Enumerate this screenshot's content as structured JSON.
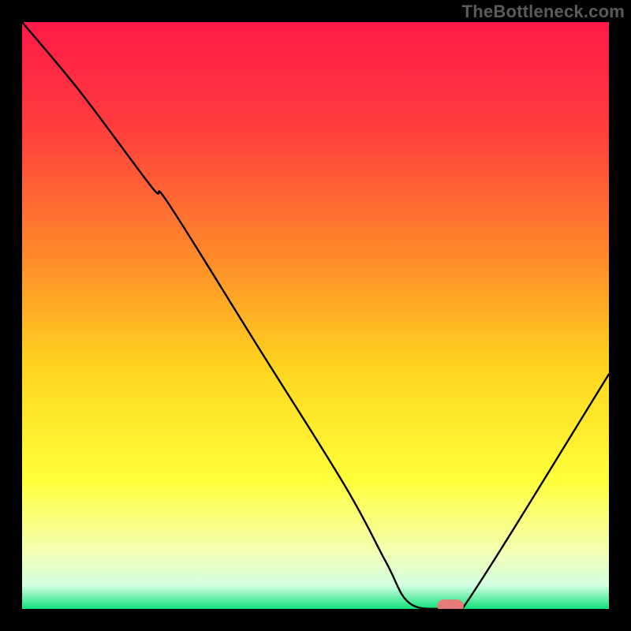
{
  "watermark": "TheBottleneck.com",
  "chart_data": {
    "type": "line",
    "title": "",
    "xlabel": "",
    "ylabel": "",
    "xlim": [
      0,
      100
    ],
    "ylim": [
      0,
      100
    ],
    "grid": false,
    "legend": false,
    "background_gradient": {
      "stops": [
        {
          "pos": 0.0,
          "color": "#ff1a49"
        },
        {
          "pos": 0.18,
          "color": "#ff3d3d"
        },
        {
          "pos": 0.4,
          "color": "#ff8a2a"
        },
        {
          "pos": 0.58,
          "color": "#ffd21f"
        },
        {
          "pos": 0.78,
          "color": "#ffff3a"
        },
        {
          "pos": 0.9,
          "color": "#f4ffb0"
        },
        {
          "pos": 0.96,
          "color": "#d3ffe3"
        },
        {
          "pos": 1.0,
          "color": "#11e07a"
        }
      ]
    },
    "series": [
      {
        "name": "bottleneck-curve",
        "color": "#000000",
        "x": [
          0,
          10,
          22,
          25,
          40,
          55,
          62,
          66,
          72,
          75,
          100
        ],
        "y": [
          100,
          88,
          72,
          69,
          45,
          21,
          8,
          1,
          0,
          0,
          40
        ]
      }
    ],
    "marker": {
      "name": "optimal-point",
      "x": 73,
      "y": 0.5,
      "width": 4.5,
      "height": 2.2,
      "color": "#e47a7a"
    }
  }
}
